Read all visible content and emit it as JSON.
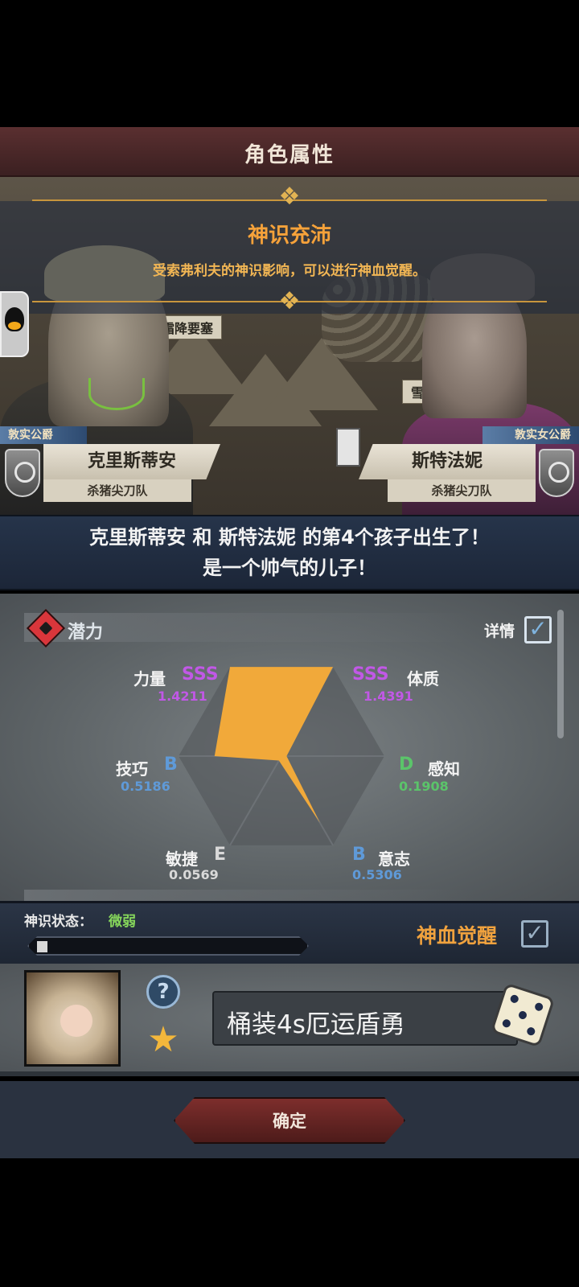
{
  "header": {
    "title": "角色属性"
  },
  "scene": {
    "map_labels": [
      "霜降要塞",
      "雪梢"
    ],
    "banner_title": "神识充沛",
    "banner_subtitle": "受索弗利夫的神识影响，可以进行神血觉醒。"
  },
  "parents": {
    "father": {
      "rank": "敦实公爵",
      "name": "克里斯蒂安",
      "team": "杀猪尖刀队"
    },
    "mother": {
      "rank": "敦实女公爵",
      "name": "斯特法妮",
      "team": "杀猪尖刀队"
    }
  },
  "announcement": {
    "line1": "克里斯蒂安 和 斯特法妮 的第4个孩子出生了！",
    "line2": "是一个帅气的儿子！"
  },
  "potential": {
    "title": "潜力",
    "detail_label": "详情",
    "detail_checked": true,
    "stats": [
      {
        "name": "力量",
        "grade": "SSS",
        "value": "1.4211",
        "level": 1.0
      },
      {
        "name": "体质",
        "grade": "SSS",
        "value": "1.4391",
        "level": 1.0
      },
      {
        "name": "感知",
        "grade": "D",
        "value": "0.1908",
        "level": 0.0
      },
      {
        "name": "意志",
        "grade": "B",
        "value": "0.5306",
        "level": 0.75
      },
      {
        "name": "敏捷",
        "grade": "E",
        "value": "0.0569",
        "level": 0.0
      },
      {
        "name": "技巧",
        "grade": "B",
        "value": "0.5186",
        "level": 0.65
      }
    ],
    "grade_colors": {
      "SSS": "#c158e6",
      "B": "#5f9ad8",
      "D": "#5bc46a",
      "E": "#d9d9d9"
    },
    "fill_color": "#f1a93a"
  },
  "divine_status": {
    "label": "神识状态：",
    "value": "微弱",
    "progress": 0.04,
    "awaken_label": "神血觉醒",
    "awaken_checked": true
  },
  "child": {
    "name": "桶装4s厄运盾勇",
    "help_icon": "question-icon",
    "star_icon": "star-icon",
    "dice_icon": "dice-icon"
  },
  "footer": {
    "confirm_label": "确定"
  }
}
